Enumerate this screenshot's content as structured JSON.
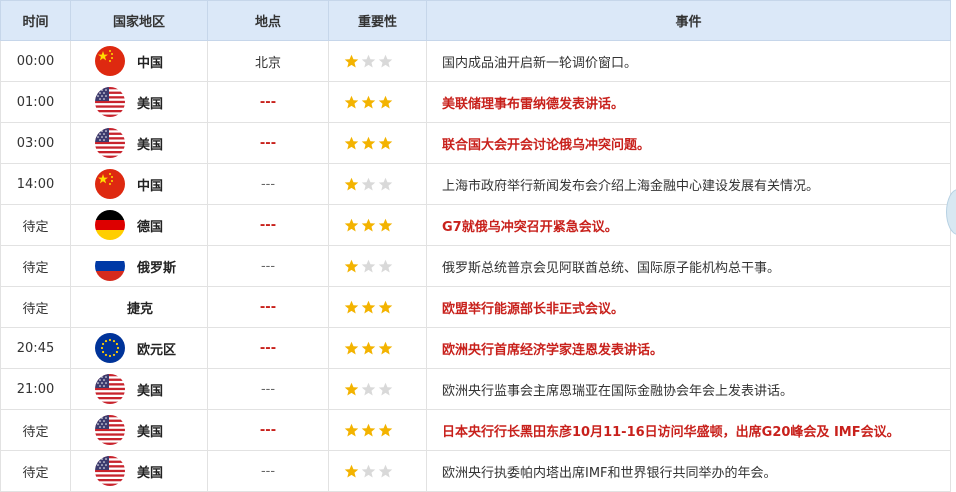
{
  "headers": {
    "time": "时间",
    "country": "国家地区",
    "location": "地点",
    "importance": "重要性",
    "event": "事件"
  },
  "colors": {
    "highlight": "#c8211c",
    "star_on": "#f3b300",
    "star_off": "#d9d9d9",
    "header_bg": "#dbe8f8"
  },
  "rows": [
    {
      "time": "00:00",
      "flag": "cn",
      "country": "中国",
      "location": "北京",
      "stars": 1,
      "event": "国内成品油开启新一轮调价窗口。",
      "high": false
    },
    {
      "time": "01:00",
      "flag": "us",
      "country": "美国",
      "location": "---",
      "stars": 3,
      "event": "美联储理事布雷纳德发表讲话。",
      "high": true
    },
    {
      "time": "03:00",
      "flag": "us",
      "country": "美国",
      "location": "---",
      "stars": 3,
      "event": "联合国大会开会讨论俄乌冲突问题。",
      "high": true
    },
    {
      "time": "14:00",
      "flag": "cn",
      "country": "中国",
      "location": "---",
      "stars": 1,
      "event": "上海市政府举行新闻发布会介绍上海金融中心建设发展有关情况。",
      "high": false
    },
    {
      "time": "待定",
      "flag": "de",
      "country": "德国",
      "location": "---",
      "stars": 3,
      "event": "G7就俄乌冲突召开紧急会议。",
      "high": true
    },
    {
      "time": "待定",
      "flag": "ru",
      "country": "俄罗斯",
      "location": "---",
      "stars": 1,
      "event": "俄罗斯总统普京会见阿联酋总统、国际原子能机构总干事。",
      "high": false
    },
    {
      "time": "待定",
      "flag": "none",
      "country": "捷克",
      "location": "---",
      "stars": 3,
      "event": "欧盟举行能源部长非正式会议。",
      "high": true
    },
    {
      "time": "20:45",
      "flag": "eu",
      "country": "欧元区",
      "location": "---",
      "stars": 3,
      "event": "欧洲央行首席经济学家连恩发表讲话。",
      "high": true
    },
    {
      "time": "21:00",
      "flag": "us",
      "country": "美国",
      "location": "---",
      "stars": 1,
      "event": "欧洲央行监事会主席恩瑞亚在国际金融协会年会上发表讲话。",
      "high": false
    },
    {
      "time": "待定",
      "flag": "us",
      "country": "美国",
      "location": "---",
      "stars": 3,
      "event": "日本央行行长黑田东彦10月11-16日访问华盛顿，出席G20峰会及 IMF会议。",
      "high": true
    },
    {
      "time": "待定",
      "flag": "us",
      "country": "美国",
      "location": "---",
      "stars": 1,
      "event": "欧洲央行执委帕内塔出席IMF和世界银行共同举办的年会。",
      "high": false
    }
  ]
}
